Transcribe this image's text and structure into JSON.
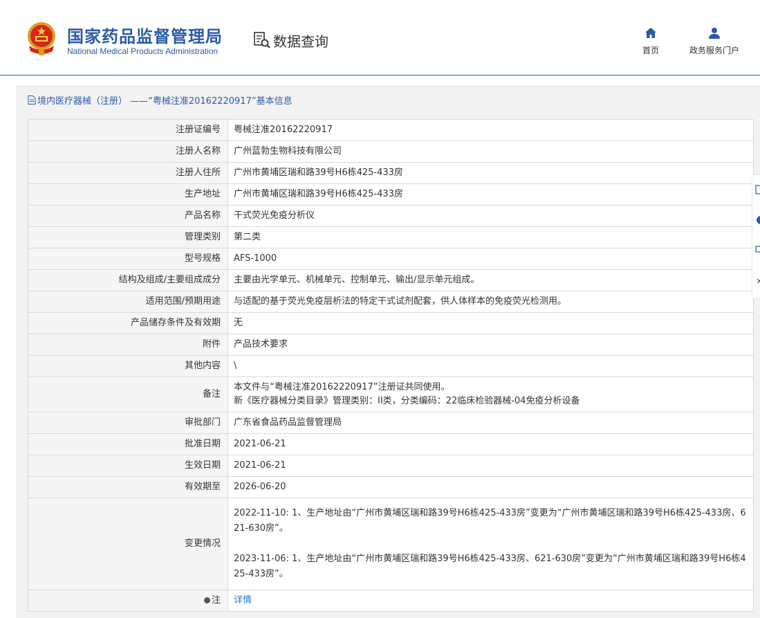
{
  "header": {
    "org_cn": "国家药品监督管理局",
    "org_en": "National Medical Products Administration",
    "query_title": "数据查询",
    "nav": [
      {
        "label": "首页",
        "icon": "home-icon"
      },
      {
        "label": "政务服务门户",
        "icon": "user-icon"
      }
    ]
  },
  "breadcrumb": {
    "text": "境内医疗器械（注册） ——“粤械注准20162220917”基本信息"
  },
  "table": {
    "rows": [
      {
        "label": "注册证编号",
        "value": "粤械注准20162220917"
      },
      {
        "label": "注册人名称",
        "value": "广州蓝勃生物科技有限公司"
      },
      {
        "label": "注册人住所",
        "value": "广州市黄埔区瑞和路39号H6栋425-433房"
      },
      {
        "label": "生产地址",
        "value": "广州市黄埔区瑞和路39号H6栋425-433房"
      },
      {
        "label": "产品名称",
        "value": "干式荧光免疫分析仪"
      },
      {
        "label": "管理类别",
        "value": "第二类"
      },
      {
        "label": "型号规格",
        "value": "AFS-1000"
      },
      {
        "label": "结构及组成/主要组成成分",
        "value": "主要由光学单元、机械单元、控制单元、输出/显示单元组成。"
      },
      {
        "label": "适用范围/预期用途",
        "value": "与适配的基于荧光免疫层析法的特定干式试剂配套，供人体样本的免疫荧光检测用。"
      },
      {
        "label": "产品储存条件及有效期",
        "value": "无"
      },
      {
        "label": "附件",
        "value": "产品技术要求"
      },
      {
        "label": "其他内容",
        "value": "\\"
      }
    ],
    "remark": {
      "label": "备注",
      "line1": "本文件与“粤械注准20162220917”注册证共同使用。",
      "line2": "新《医疗器械分类目录》管理类别：II类，分类编码：22临床检验器械-04免疫分析设备"
    },
    "rows2": [
      {
        "label": "审批部门",
        "value": "广东省食品药品监督管理局"
      },
      {
        "label": "批准日期",
        "value": "2021-06-21"
      },
      {
        "label": "生效日期",
        "value": "2021-06-21"
      },
      {
        "label": "有效期至",
        "value": "2026-06-20"
      }
    ],
    "changes": {
      "label": "变更情况",
      "entry1": "2022-11-10: 1、生产地址由“广州市黄埔区瑞和路39号H6栋425-433房”变更为“广州市黄埔区瑞和路39号H6栋425-433房、621-630房”。",
      "entry2": "2023-11-06: 1、生产地址由“广州市黄埔区瑞和路39号H6栋425-433房、621-630房”变更为“广州市黄埔区瑞和路39号H6栋425-433房”。"
    },
    "note": {
      "label": "注",
      "link": "详情"
    }
  },
  "colors": {
    "brand_blue": "#2b5aa5",
    "link_blue": "#2b74c6",
    "label_bg": "#f5f5f5",
    "frame_bg": "#f2f2f2"
  }
}
